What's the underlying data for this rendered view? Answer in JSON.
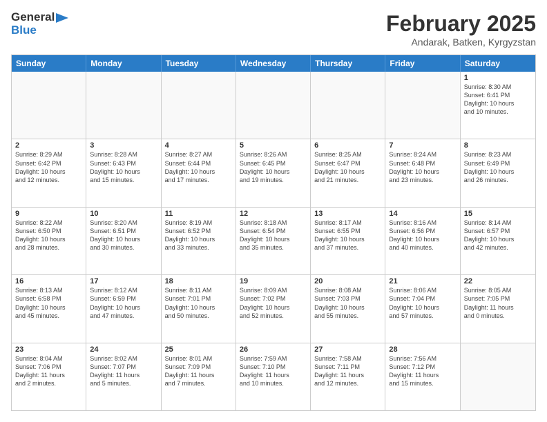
{
  "header": {
    "logo_line1": "General",
    "logo_line2": "Blue",
    "month": "February 2025",
    "location": "Andarak, Batken, Kyrgyzstan"
  },
  "weekdays": [
    "Sunday",
    "Monday",
    "Tuesday",
    "Wednesday",
    "Thursday",
    "Friday",
    "Saturday"
  ],
  "rows": [
    [
      {
        "day": "",
        "text": ""
      },
      {
        "day": "",
        "text": ""
      },
      {
        "day": "",
        "text": ""
      },
      {
        "day": "",
        "text": ""
      },
      {
        "day": "",
        "text": ""
      },
      {
        "day": "",
        "text": ""
      },
      {
        "day": "1",
        "text": "Sunrise: 8:30 AM\nSunset: 6:41 PM\nDaylight: 10 hours\nand 10 minutes."
      }
    ],
    [
      {
        "day": "2",
        "text": "Sunrise: 8:29 AM\nSunset: 6:42 PM\nDaylight: 10 hours\nand 12 minutes."
      },
      {
        "day": "3",
        "text": "Sunrise: 8:28 AM\nSunset: 6:43 PM\nDaylight: 10 hours\nand 15 minutes."
      },
      {
        "day": "4",
        "text": "Sunrise: 8:27 AM\nSunset: 6:44 PM\nDaylight: 10 hours\nand 17 minutes."
      },
      {
        "day": "5",
        "text": "Sunrise: 8:26 AM\nSunset: 6:45 PM\nDaylight: 10 hours\nand 19 minutes."
      },
      {
        "day": "6",
        "text": "Sunrise: 8:25 AM\nSunset: 6:47 PM\nDaylight: 10 hours\nand 21 minutes."
      },
      {
        "day": "7",
        "text": "Sunrise: 8:24 AM\nSunset: 6:48 PM\nDaylight: 10 hours\nand 23 minutes."
      },
      {
        "day": "8",
        "text": "Sunrise: 8:23 AM\nSunset: 6:49 PM\nDaylight: 10 hours\nand 26 minutes."
      }
    ],
    [
      {
        "day": "9",
        "text": "Sunrise: 8:22 AM\nSunset: 6:50 PM\nDaylight: 10 hours\nand 28 minutes."
      },
      {
        "day": "10",
        "text": "Sunrise: 8:20 AM\nSunset: 6:51 PM\nDaylight: 10 hours\nand 30 minutes."
      },
      {
        "day": "11",
        "text": "Sunrise: 8:19 AM\nSunset: 6:52 PM\nDaylight: 10 hours\nand 33 minutes."
      },
      {
        "day": "12",
        "text": "Sunrise: 8:18 AM\nSunset: 6:54 PM\nDaylight: 10 hours\nand 35 minutes."
      },
      {
        "day": "13",
        "text": "Sunrise: 8:17 AM\nSunset: 6:55 PM\nDaylight: 10 hours\nand 37 minutes."
      },
      {
        "day": "14",
        "text": "Sunrise: 8:16 AM\nSunset: 6:56 PM\nDaylight: 10 hours\nand 40 minutes."
      },
      {
        "day": "15",
        "text": "Sunrise: 8:14 AM\nSunset: 6:57 PM\nDaylight: 10 hours\nand 42 minutes."
      }
    ],
    [
      {
        "day": "16",
        "text": "Sunrise: 8:13 AM\nSunset: 6:58 PM\nDaylight: 10 hours\nand 45 minutes."
      },
      {
        "day": "17",
        "text": "Sunrise: 8:12 AM\nSunset: 6:59 PM\nDaylight: 10 hours\nand 47 minutes."
      },
      {
        "day": "18",
        "text": "Sunrise: 8:11 AM\nSunset: 7:01 PM\nDaylight: 10 hours\nand 50 minutes."
      },
      {
        "day": "19",
        "text": "Sunrise: 8:09 AM\nSunset: 7:02 PM\nDaylight: 10 hours\nand 52 minutes."
      },
      {
        "day": "20",
        "text": "Sunrise: 8:08 AM\nSunset: 7:03 PM\nDaylight: 10 hours\nand 55 minutes."
      },
      {
        "day": "21",
        "text": "Sunrise: 8:06 AM\nSunset: 7:04 PM\nDaylight: 10 hours\nand 57 minutes."
      },
      {
        "day": "22",
        "text": "Sunrise: 8:05 AM\nSunset: 7:05 PM\nDaylight: 11 hours\nand 0 minutes."
      }
    ],
    [
      {
        "day": "23",
        "text": "Sunrise: 8:04 AM\nSunset: 7:06 PM\nDaylight: 11 hours\nand 2 minutes."
      },
      {
        "day": "24",
        "text": "Sunrise: 8:02 AM\nSunset: 7:07 PM\nDaylight: 11 hours\nand 5 minutes."
      },
      {
        "day": "25",
        "text": "Sunrise: 8:01 AM\nSunset: 7:09 PM\nDaylight: 11 hours\nand 7 minutes."
      },
      {
        "day": "26",
        "text": "Sunrise: 7:59 AM\nSunset: 7:10 PM\nDaylight: 11 hours\nand 10 minutes."
      },
      {
        "day": "27",
        "text": "Sunrise: 7:58 AM\nSunset: 7:11 PM\nDaylight: 11 hours\nand 12 minutes."
      },
      {
        "day": "28",
        "text": "Sunrise: 7:56 AM\nSunset: 7:12 PM\nDaylight: 11 hours\nand 15 minutes."
      },
      {
        "day": "",
        "text": ""
      }
    ]
  ]
}
